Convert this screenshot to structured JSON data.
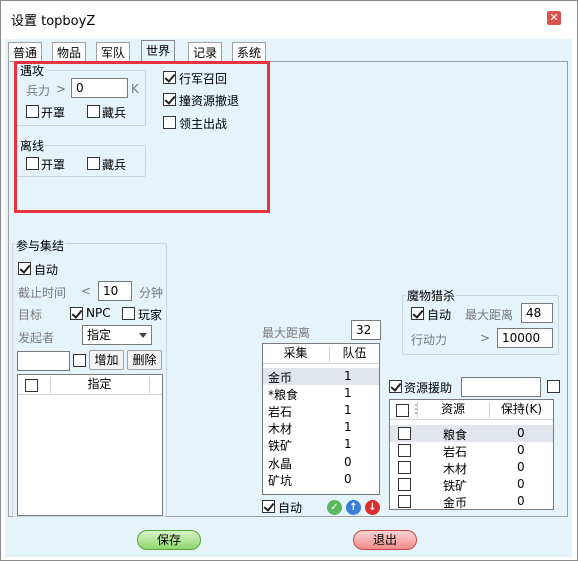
{
  "window": {
    "title": "设置 topboyZ",
    "close_glyph": "✕"
  },
  "tabs": [
    {
      "label": "普通"
    },
    {
      "label": "物品"
    },
    {
      "label": "军队"
    },
    {
      "label": "世界"
    },
    {
      "label": "记录"
    },
    {
      "label": "系统"
    }
  ],
  "encounter": {
    "group_label": "遇攻",
    "troops_label": "兵力",
    "gt": ">",
    "troops_value": "0",
    "unit": "K",
    "open_cover": {
      "label": "开罩",
      "checked": false
    },
    "hide_troops": {
      "label": "藏兵",
      "checked": false
    }
  },
  "right_options": {
    "march_recall": {
      "label": "行军召回",
      "checked": true
    },
    "resource_retreat": {
      "label": "撞资源撤退",
      "checked": true
    },
    "lord_battle": {
      "label": "领主出战",
      "checked": false
    }
  },
  "offline": {
    "group_label": "离线",
    "open_cover": {
      "label": "开罩",
      "checked": false
    },
    "hide_troops": {
      "label": "藏兵",
      "checked": false
    }
  },
  "rally": {
    "group_label": "参与集结",
    "auto": {
      "label": "自动",
      "checked": true
    },
    "deadline_label": "截止时间",
    "lt": "<",
    "deadline_value": "10",
    "minutes": "分钟",
    "target_label": "目标",
    "npc": {
      "label": "NPC",
      "checked": true
    },
    "player": {
      "label": "玩家",
      "checked": false
    },
    "initiator_label": "发起者",
    "initiator_value": "指定",
    "name_input": "",
    "add_button": "增加",
    "delete_button": "删除",
    "list_header": "指定"
  },
  "gather": {
    "max_distance_label": "最大距离",
    "max_distance_value": "32",
    "col_type": "采集",
    "col_team": "队伍",
    "rows": [
      {
        "name": "金币",
        "value": "1"
      },
      {
        "name": "*粮食",
        "value": "1"
      },
      {
        "name": "岩石",
        "value": "1"
      },
      {
        "name": "木材",
        "value": "1"
      },
      {
        "name": "铁矿",
        "value": "1"
      },
      {
        "name": "水晶",
        "value": "0"
      },
      {
        "name": "矿坑",
        "value": "0"
      }
    ],
    "auto": {
      "label": "自动",
      "checked": true
    }
  },
  "monster": {
    "group_label": "魔物猎杀",
    "auto": {
      "label": "自动",
      "checked": true
    },
    "max_distance_label": "最大距离",
    "max_distance_value": "48",
    "ap_label": "行动力",
    "gt": ">",
    "ap_value": "10000"
  },
  "aid": {
    "checkbox": {
      "label": "资源援助",
      "checked": true
    },
    "target_input": "",
    "col_resource": "资源",
    "col_keep": "保持(K)",
    "rows": [
      {
        "name": "粮食",
        "value": "0"
      },
      {
        "name": "岩石",
        "value": "0"
      },
      {
        "name": "木材",
        "value": "0"
      },
      {
        "name": "铁矿",
        "value": "0"
      },
      {
        "name": "金币",
        "value": "0"
      }
    ]
  },
  "footer": {
    "save": "保存",
    "exit": "退出"
  },
  "colors": {
    "accent_highlight": "#e8333f",
    "panel_bg": "#e5f3fb"
  }
}
